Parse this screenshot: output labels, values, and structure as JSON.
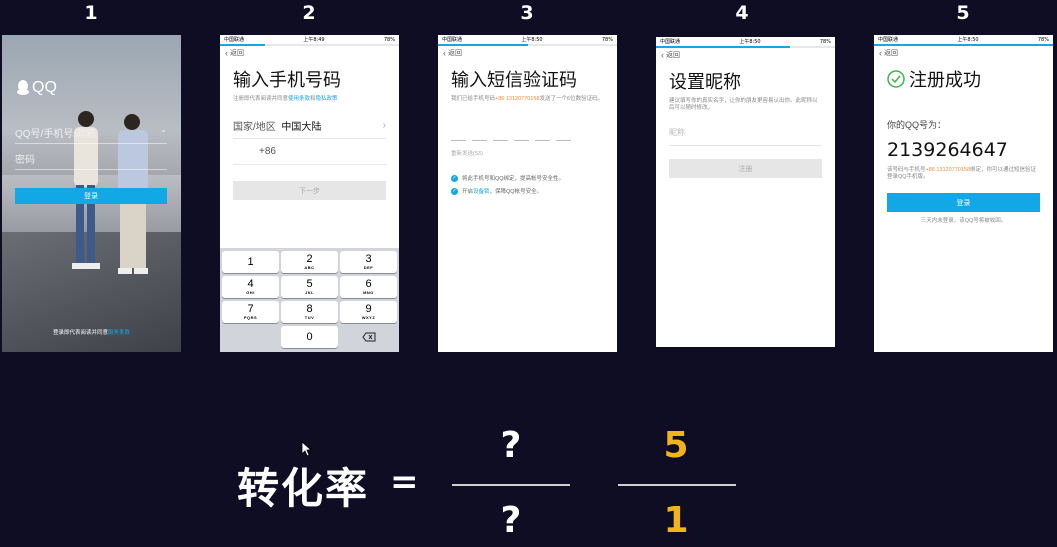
{
  "steps": [
    "1",
    "2",
    "3",
    "4",
    "5"
  ],
  "status": {
    "carrier": "中国联通",
    "time_a": "上午8:49",
    "time_b": "上午8:50",
    "battery": "78%"
  },
  "screen1": {
    "logo": "QQ",
    "account_placeholder": "QQ号/手机号/邮箱",
    "password_placeholder": "密码",
    "login_button": "登录",
    "agree_text": "登录即代表阅读并同意",
    "agree_link": "服务条款"
  },
  "screen2": {
    "back": "返回",
    "title": "输入手机号码",
    "sub_text": "注册即代表阅读并同意",
    "sub_link1": "使用条款",
    "sub_and": "和",
    "sub_link2": "隐私政策",
    "region_label": "国家/地区",
    "region_value": "中国大陆",
    "code": "+86",
    "next_button": "下一步",
    "keys": [
      {
        "d": "1",
        "l": ""
      },
      {
        "d": "2",
        "l": "ABC"
      },
      {
        "d": "3",
        "l": "DEF"
      },
      {
        "d": "4",
        "l": "GHI"
      },
      {
        "d": "5",
        "l": "JKL"
      },
      {
        "d": "6",
        "l": "MNO"
      },
      {
        "d": "7",
        "l": "PQRS"
      },
      {
        "d": "8",
        "l": "TUV"
      },
      {
        "d": "9",
        "l": "WXYZ"
      },
      {
        "d": "0",
        "l": ""
      }
    ]
  },
  "screen3": {
    "back": "返回",
    "title": "输入短信验证码",
    "sub_text": "我们已给手机号码",
    "sub_phone": "+86 13120770158",
    "sub_text2": "发送了一个6位数验证码。",
    "resend": "重新发送(53)",
    "check1": "将此手机号和QQ绑定，提高帐号安全性。",
    "check2_a": "开启",
    "check2_link": "设备锁",
    "check2_b": "，保障QQ帐号安全。"
  },
  "screen4": {
    "back": "返回",
    "title": "设置昵称",
    "sub": "建议填写你的真实名字，让你的朋友更容易认出你。此昵称以后可以随时修改。",
    "nick_placeholder": "昵称",
    "register_button": "注册"
  },
  "screen5": {
    "back": "返回",
    "title": "注册成功",
    "qq_label": "你的QQ号为：",
    "qq_number": "2139264647",
    "note_a": "该号码与手机号",
    "note_phone": "+86 13120770158",
    "note_b": "绑定，你可以通过短信验证登录QQ手机版。",
    "login_button": "登录",
    "footer": "三天内未登录，该QQ号将被收回。"
  },
  "formula": {
    "label": "转化率",
    "equals": "=",
    "num1": "?",
    "den1": "?",
    "num2": "5",
    "den2": "1"
  },
  "colors": {
    "accent": "#12a8e6",
    "gold": "#f3b31c",
    "bg": "#0f0d24",
    "warn": "#f08a3c",
    "success": "#3bb54a"
  }
}
